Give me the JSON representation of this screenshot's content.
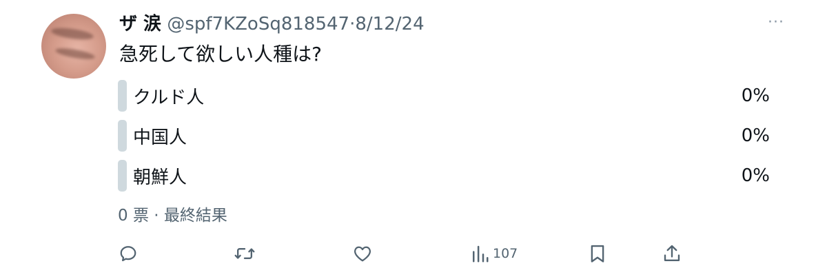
{
  "tweet": {
    "author_name": "ザ 涙",
    "handle": "@spf7KZoSq818547",
    "separator": "·",
    "date": "8/12/24",
    "more_label": "···",
    "text": "急死して欲しい人種は?"
  },
  "poll": {
    "options": [
      {
        "label": "クルド人",
        "percent": "0%"
      },
      {
        "label": "中国人",
        "percent": "0%"
      },
      {
        "label": "朝鮮人",
        "percent": "0%"
      }
    ],
    "votes": "0 票",
    "meta_separator": "·",
    "status": "最終結果"
  },
  "actions": {
    "reply_icon": "reply-icon",
    "retweet_icon": "retweet-icon",
    "like_icon": "like-icon",
    "views_icon": "views-icon",
    "views_count": "107",
    "bookmark_icon": "bookmark-icon",
    "share_icon": "share-icon"
  },
  "colors": {
    "text_primary": "#0f1419",
    "text_secondary": "#536471",
    "poll_bar": "#cfd9de"
  }
}
